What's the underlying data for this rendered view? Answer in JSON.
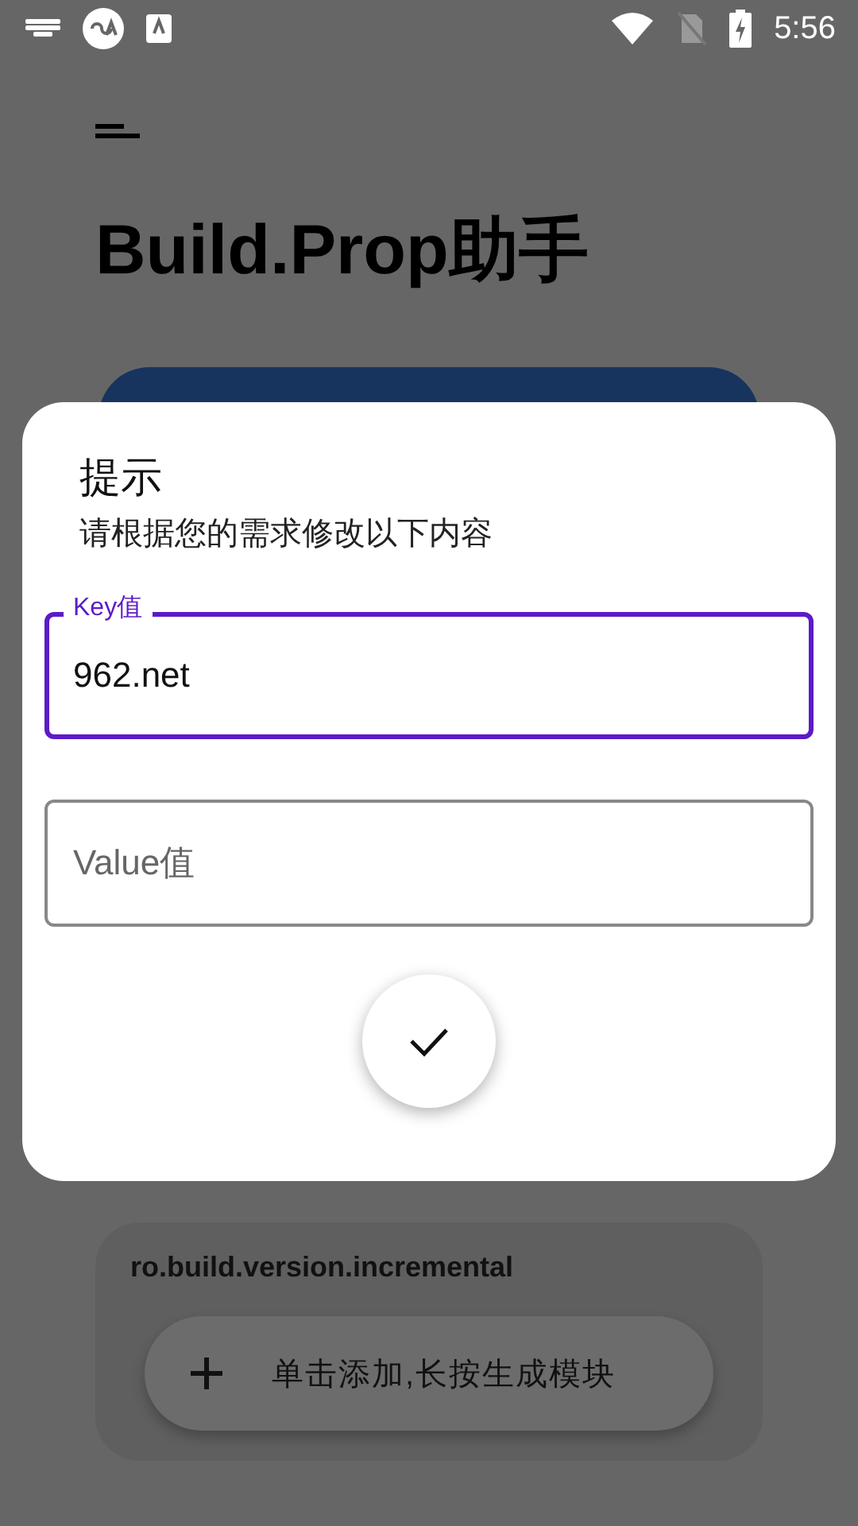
{
  "status_bar": {
    "time": "5:56"
  },
  "app": {
    "title": "Build.Prop助手"
  },
  "dialog": {
    "title": "提示",
    "message": "请根据您的需求修改以下内容",
    "fields": [
      {
        "label": "Key值",
        "value": "962.net",
        "focused": true
      },
      {
        "placeholder": "Value值",
        "focused": false
      }
    ]
  },
  "list": {
    "items": [
      {
        "key": "ro.build.version.incremental"
      }
    ]
  },
  "fab": {
    "label": "单击添加,长按生成模块"
  }
}
